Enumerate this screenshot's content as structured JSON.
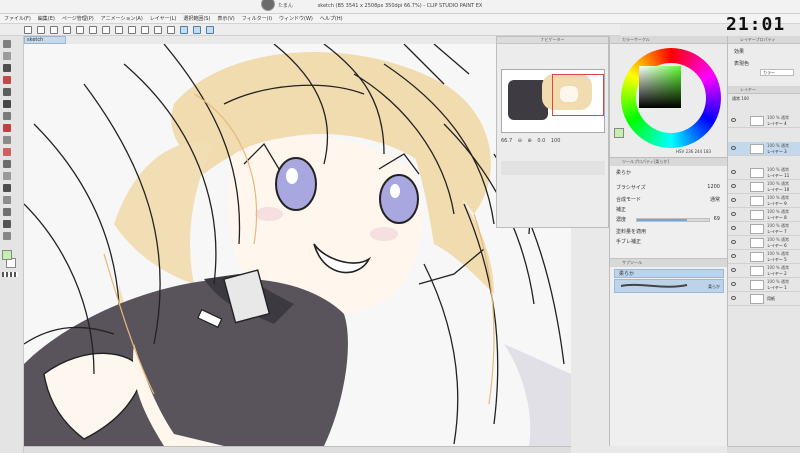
{
  "window": {
    "title": "sketch (B5 3541 x 2508px 350dpi 66.7%) - CLIP STUDIO PAINT EX",
    "user": "たまん"
  },
  "clock": "21:01",
  "menu": [
    "ファイル(F)",
    "編集(E)",
    "ページ管理(P)",
    "アニメーション(A)",
    "レイヤー(L)",
    "選択範囲(S)",
    "表示(V)",
    "フィルター(I)",
    "ウィンドウ(W)",
    "ヘルプ(H)"
  ],
  "document_tab": "sketch",
  "navigator": {
    "title": "ナビゲーター",
    "zoom": "66.7",
    "angle": "0.0",
    "zoom_pct": "100"
  },
  "color_panel": {
    "title": "カラーサークル",
    "h": "236",
    "s": "244",
    "v": "183",
    "fg_color": "#c5eeb0",
    "mode": "HSV"
  },
  "tool_property": {
    "title": "ツールプロパティ[柔らか]",
    "tool_name": "柔らか",
    "brush_size_label": "ブラシサイズ",
    "brush_size": "1200",
    "blend_label": "合成モード",
    "blend_value": "通常",
    "blur_label": "補正",
    "density_label": "濃度",
    "density": "69",
    "density_fraction": 0.69,
    "extra1": "塗料量を適用",
    "extra2": "手ブレ補正"
  },
  "sub_tool": {
    "title": "サブツール",
    "group": "柔らか",
    "item": "柔らか"
  },
  "layer_property": {
    "title": "レイヤープロパティ",
    "effect_label": "効果",
    "color_label": "表現色",
    "color_value": "カラー"
  },
  "layers": {
    "title": "レイヤー",
    "blend_mode": "通常",
    "opacity": "100",
    "items": [
      {
        "mode": "100 % 通常",
        "name": "レイヤー 4"
      },
      {
        "mode": "100 % 通常",
        "name": "レイヤー 3"
      },
      {
        "mode": "100 % 通常",
        "name": "レイヤー 11"
      },
      {
        "mode": "100 % 通常",
        "name": "レイヤー 10"
      },
      {
        "mode": "100 % 通常",
        "name": "レイヤー 9"
      },
      {
        "mode": "100 % 通常",
        "name": "レイヤー 8"
      },
      {
        "mode": "100 % 通常",
        "name": "レイヤー 7"
      },
      {
        "mode": "100 % 通常",
        "name": "レイヤー 6"
      },
      {
        "mode": "100 % 通常",
        "name": "レイヤー 5"
      },
      {
        "mode": "100 % 通常",
        "name": "レイヤー 2"
      },
      {
        "mode": "100 % 通常",
        "name": "レイヤー 1"
      }
    ],
    "paper": "用紙"
  },
  "colors": {
    "accent": "#4a7fb5",
    "selection": "#c4d8ec",
    "hair": "#f1dcb0",
    "eye": "#a9a7e0",
    "outfit": "#59545c"
  }
}
